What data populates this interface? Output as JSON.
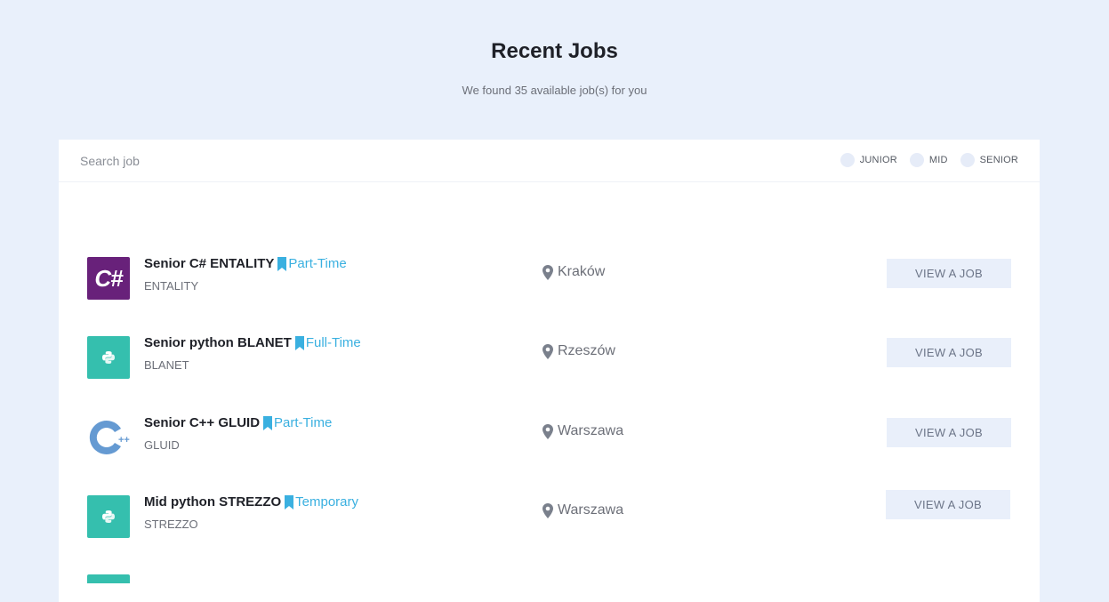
{
  "header": {
    "title": "Recent Jobs",
    "subtitle": "We found 35 available job(s) for you"
  },
  "search": {
    "placeholder": "Search job",
    "value": ""
  },
  "filters": [
    {
      "label": "JUNIOR"
    },
    {
      "label": "MID"
    },
    {
      "label": "SENIOR"
    }
  ],
  "jobs": [
    {
      "title": "Senior C# ENTALITY",
      "type": "Part-Time",
      "company": "ENTALITY",
      "location": "Kraków",
      "logo_icon": "csharp-logo-icon",
      "logo_text": "C#",
      "button": "VIEW A JOB"
    },
    {
      "title": "Senior python BLANET",
      "type": "Full-Time",
      "company": "BLANET",
      "location": "Rzeszów",
      "logo_icon": "python-logo-icon",
      "button": "VIEW A JOB"
    },
    {
      "title": "Senior C++ GLUID",
      "type": "Part-Time",
      "company": "GLUID",
      "location": "Warszawa",
      "logo_icon": "cpp-logo-icon",
      "button": "VIEW A JOB"
    },
    {
      "title": "Mid python STREZZO",
      "type": "Temporary",
      "company": "STREZZO",
      "location": "Warszawa",
      "logo_icon": "python-logo-icon",
      "button": "VIEW A JOB"
    }
  ],
  "colors": {
    "background": "#e9f0fb",
    "accent": "#3ab0e0",
    "csharp": "#68217a",
    "python": "#35bfae",
    "cpp": "#659ad2"
  }
}
